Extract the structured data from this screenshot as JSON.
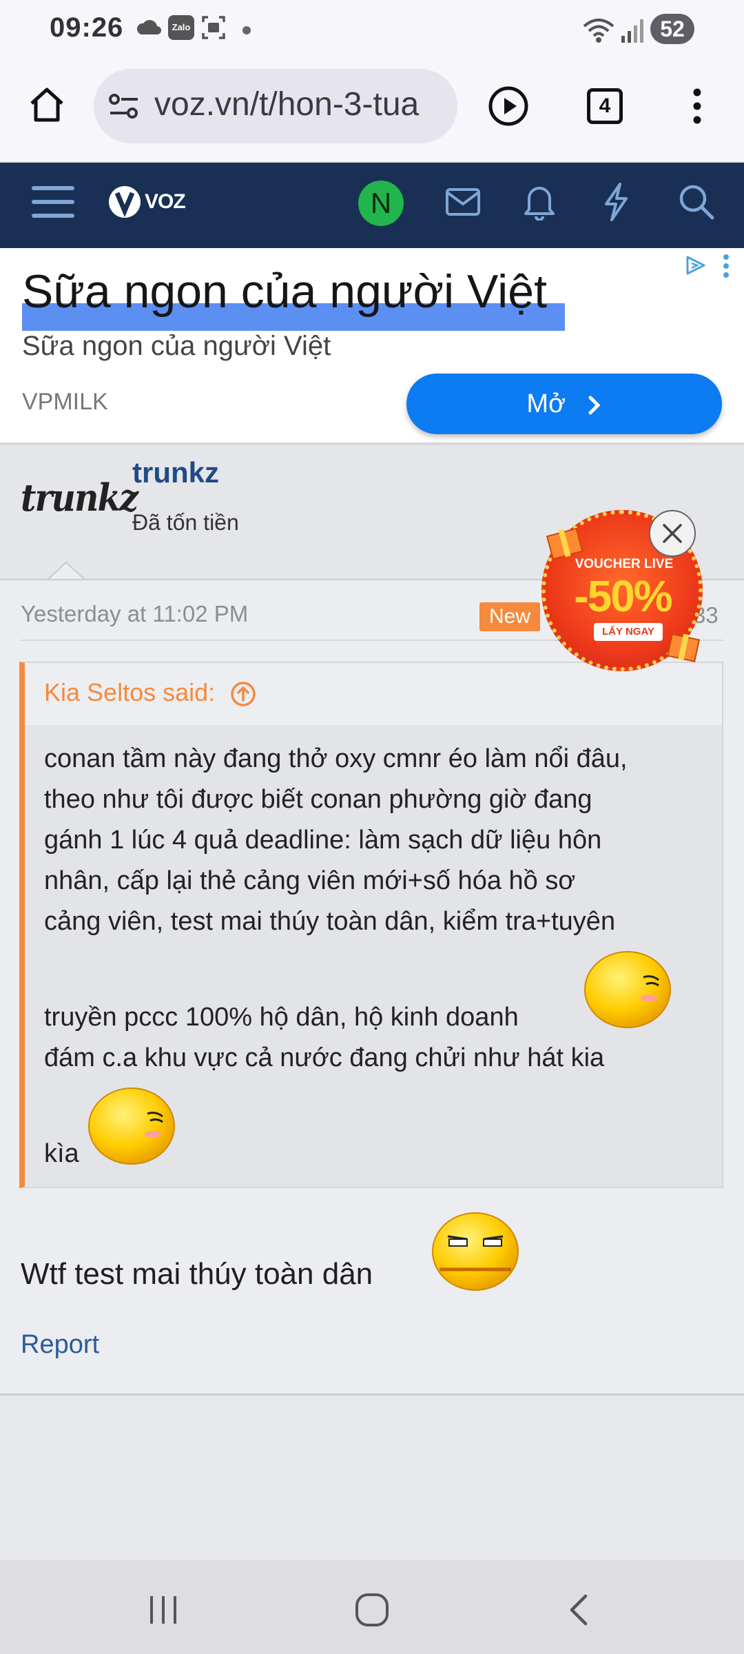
{
  "status_bar": {
    "time": "09:26",
    "battery": "52",
    "icons": [
      "cloud-icon",
      "zalo-icon",
      "screenshot-icon",
      "dot-icon",
      "wifi-icon",
      "signal-icon"
    ],
    "zalo_label": "Zalo"
  },
  "browser": {
    "url": "voz.vn/t/hon-3-tua",
    "tab_count": "4",
    "icons": [
      "home-icon",
      "site-settings-icon",
      "play-icon",
      "tabs-icon",
      "more-icon"
    ]
  },
  "voz_nav": {
    "logo_text": "VOZ",
    "avatar_initial": "N",
    "icons": [
      "menu-icon",
      "mail-icon",
      "bell-icon",
      "lightning-icon",
      "search-icon"
    ]
  },
  "ad": {
    "headline": "Sữa ngon của người Việt",
    "subtitle": "Sữa ngon của người Việt",
    "brand": "VPMILK",
    "button_label": "Mở"
  },
  "post": {
    "username": "trunkz",
    "user_title": "Đã tốn tiền",
    "avatar_text": "trunkz",
    "date": "Yesterday at 11:02 PM",
    "new_badge": "New",
    "post_number": "33",
    "quote": {
      "author": "Kia Seltos said:",
      "lines": [
        "conan tầm này đang thở oxy cmnr éo làm nổi đâu,",
        "theo như tôi được biết conan phường giờ đang",
        "gánh 1 lúc 4 quả deadline: làm sạch dữ liệu hôn",
        "nhân, cấp lại thẻ cảng viên mới+số hóa hồ sơ",
        "cảng viên, test mai thúy toàn dân, kiểm tra+tuyên",
        "truyền pccc 100% hộ dân, hộ kinh doanh",
        "đám c.a khu vực cả nước đang chửi như hát kia",
        "kìa"
      ]
    },
    "reply_text": "Wtf test mai thúy toàn dân",
    "report_label": "Report"
  },
  "voucher": {
    "title": "VOUCHER LIVE",
    "percent": "-50%",
    "button": "LẤY NGAY"
  },
  "android_nav": {
    "icons": [
      "recents-icon",
      "home-circle-icon",
      "back-icon"
    ]
  },
  "colors": {
    "voz_nav_bg": "#193054",
    "accent_orange": "#f58a3d",
    "ad_button": "#0d7bf2",
    "username_blue": "#1f4b86"
  }
}
